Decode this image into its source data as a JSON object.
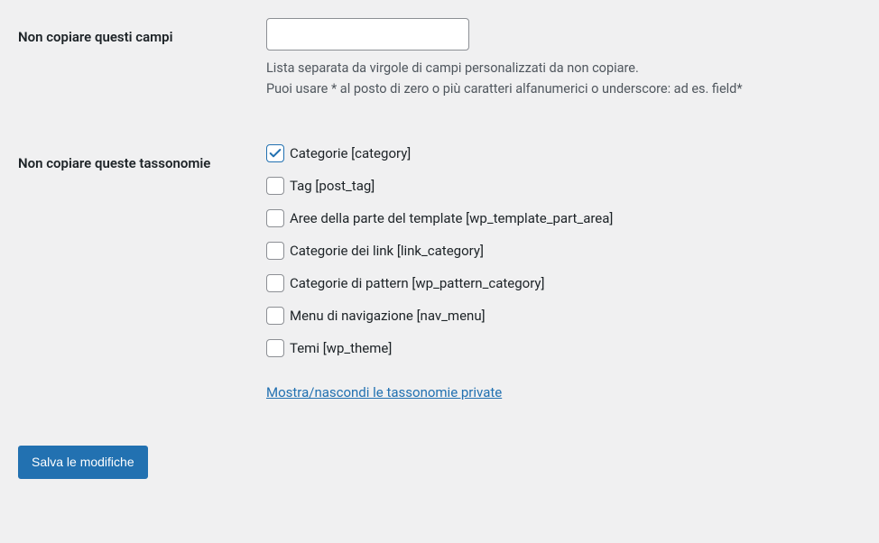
{
  "fields": {
    "not_copy_fields": {
      "label": "Non copiare questi campi",
      "value": "",
      "description_line1": "Lista separata da virgole di campi personalizzati da non copiare.",
      "description_line2": "Puoi usare * al posto di zero o più caratteri alfanumerici o underscore: ad es. field*"
    },
    "not_copy_taxonomies": {
      "label": "Non copiare queste tassonomie",
      "items": [
        {
          "label": "Categorie [category]",
          "checked": true
        },
        {
          "label": "Tag [post_tag]",
          "checked": false
        },
        {
          "label": "Aree della parte del template [wp_template_part_area]",
          "checked": false
        },
        {
          "label": "Categorie dei link [link_category]",
          "checked": false
        },
        {
          "label": "Categorie di pattern [wp_pattern_category]",
          "checked": false
        },
        {
          "label": "Menu di navigazione [nav_menu]",
          "checked": false
        },
        {
          "label": "Temi [wp_theme]",
          "checked": false
        }
      ],
      "toggle_link": "Mostra/nascondi le tassonomie private"
    }
  },
  "submit": {
    "label": "Salva le modifiche"
  }
}
